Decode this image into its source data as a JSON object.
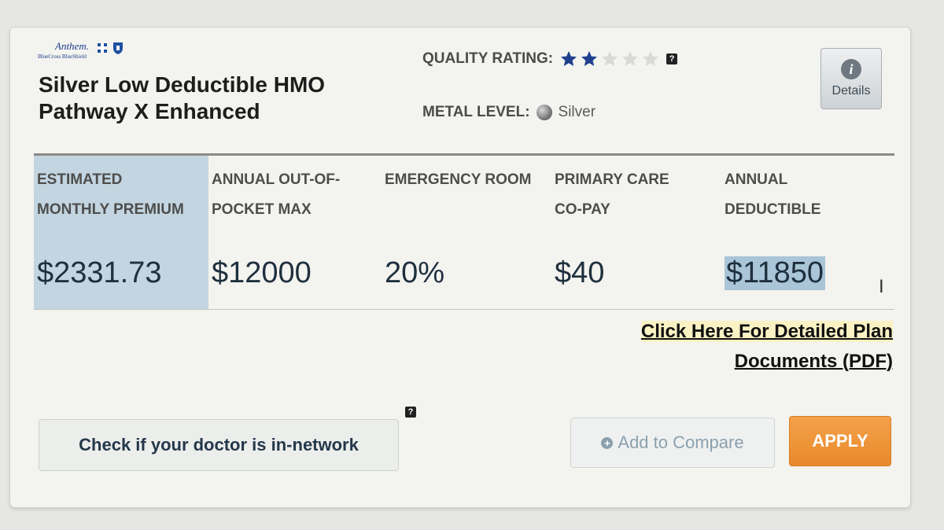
{
  "logo": {
    "brand": "Anthem.",
    "sub": "BlueCross BlueShield"
  },
  "plan": {
    "title_line1": "Silver Low Deductible HMO",
    "title_line2": "Pathway X Enhanced"
  },
  "quality": {
    "label": "QUALITY RATING:",
    "rating": 2,
    "max": 5,
    "filled_color": "#1f3f8f",
    "empty_color": "#d9dad6",
    "help": "?"
  },
  "metal": {
    "label": "METAL LEVEL:",
    "value": "Silver"
  },
  "details": {
    "label": "Details",
    "icon": "info-icon"
  },
  "columns": [
    {
      "head1": "ESTIMATED",
      "head2": "MONTHLY PREMIUM",
      "value": "$2331.73"
    },
    {
      "head1": "ANNUAL OUT-OF-",
      "head2": "POCKET MAX",
      "value": "$12000"
    },
    {
      "head1": "EMERGENCY ROOM",
      "head2": "",
      "value": "20%"
    },
    {
      "head1": "PRIMARY CARE",
      "head2": "CO-PAY",
      "value": "$40"
    },
    {
      "head1": "ANNUAL",
      "head2": "DEDUCTIBLE",
      "value": "$11850"
    }
  ],
  "pdf_link": {
    "line1": "Click Here For Detailed Plan",
    "line2": "Documents (PDF)"
  },
  "actions": {
    "doctor": "Check if your doctor is in-network",
    "help": "?",
    "compare": "Add to Compare",
    "apply": "APPLY"
  }
}
